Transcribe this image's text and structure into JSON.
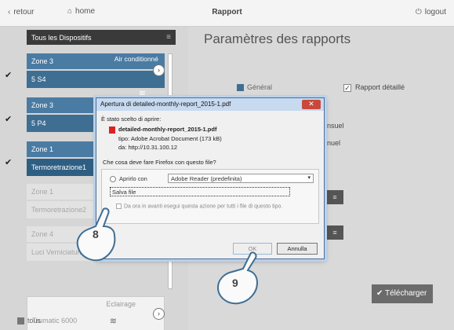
{
  "topbar": {
    "back": "retour",
    "home": "home",
    "title": "Rapport",
    "logout": "logout"
  },
  "left": {
    "all_devices": "Tous les Dispositifs",
    "devices": [
      {
        "zone": "Zone 3",
        "type": "Air conditionné",
        "name": "5 S4"
      },
      {
        "zone": "Zone 3",
        "name": "5 P4"
      },
      {
        "zone": "Zone 1",
        "name": "Termoretrazione1"
      },
      {
        "zone": "Zone 1",
        "name": "Termoretrazione2"
      },
      {
        "zone": "Zone 4",
        "name": "Luci Verniciatura"
      }
    ],
    "eclairage": {
      "type": "Eclairage",
      "name": "Trumatic 6000"
    },
    "tous": "tous"
  },
  "right": {
    "title": "Paramètres des rapports",
    "general": "Général",
    "detailed": "Rapport détaillé",
    "partial_monthly": "ensuel",
    "partial_annual": "nnuel",
    "download": "Télécharger"
  },
  "dialog": {
    "title": "Apertura di detailed-monthly-report_2015-1.pdf",
    "intro": "È stato scelto di aprire:",
    "filename": "detailed-monthly-report_2015-1.pdf",
    "tipo": "tipo: Adobe Acrobat Document (173 kB)",
    "da": "da: http://10.31.100.12",
    "question": "Che cosa deve fare Firefox con questo file?",
    "open_with": "Aprirlo con",
    "app": "Adobe Reader  (predefinita)",
    "save": "Salva file",
    "remember": "Da ora in avanti esegui questa azione per tutti i file di questo tipo.",
    "ok": "OK",
    "cancel": "Annulla"
  },
  "callouts": {
    "step8": "8",
    "step9": "9"
  },
  "colors": {
    "active_blue": "#3f6e93",
    "general_square": "#3f6e93"
  }
}
